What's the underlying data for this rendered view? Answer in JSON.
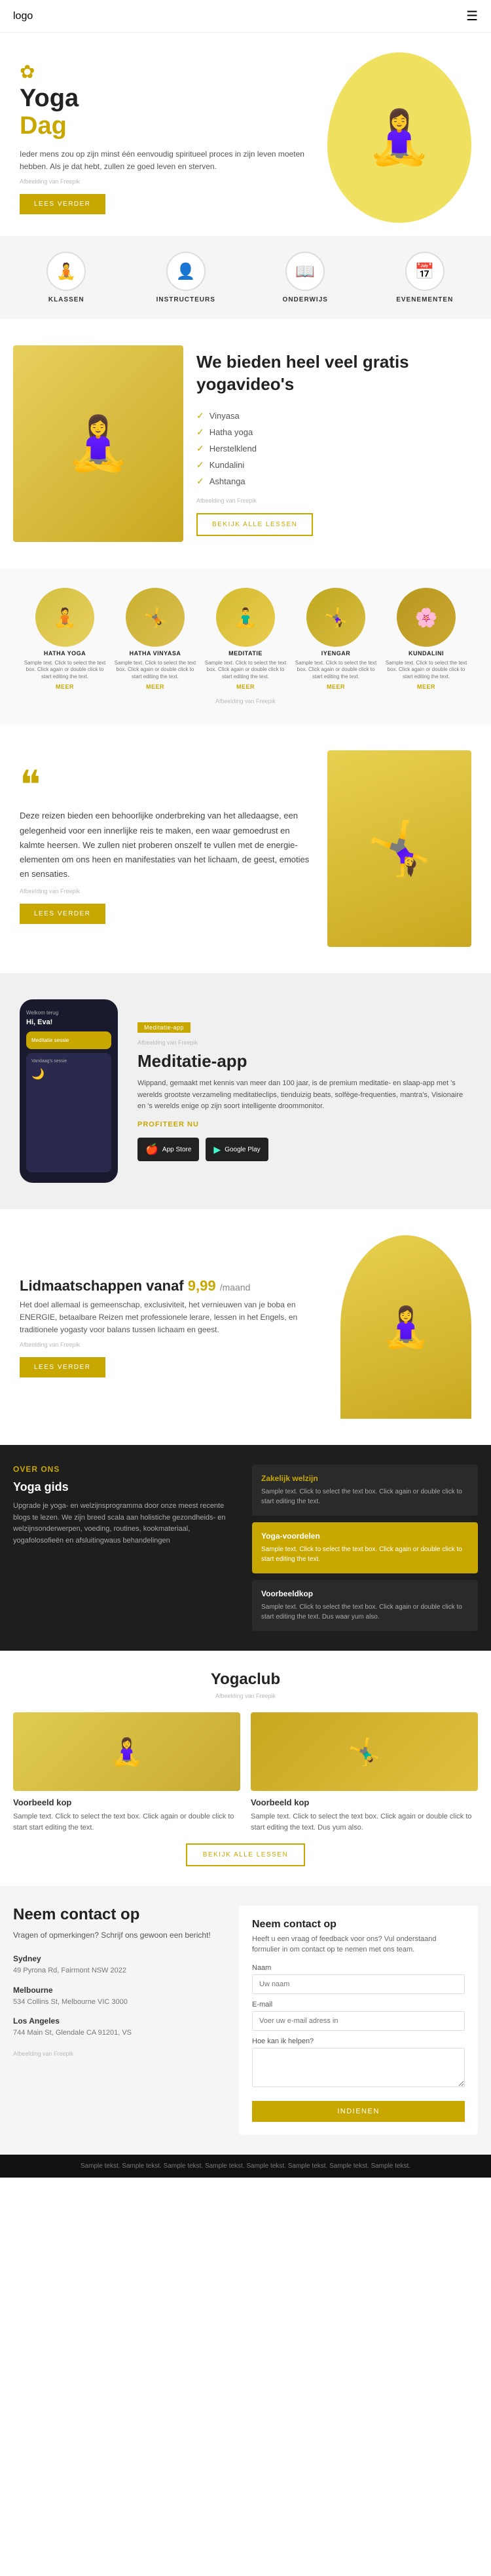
{
  "nav": {
    "logo": "logo",
    "menu_icon": "☰"
  },
  "hero": {
    "lotus_icon": "✿",
    "title_line1": "Yoga",
    "title_line2": "Dag",
    "description": "Ieder mens zou op zijn minst één eenvoudig spiritueel proces in zijn leven moeten hebben. Als je dat hebt, zullen ze goed leven en sterven.",
    "image_credit": "Afbeelding van Freepik",
    "btn_label": "LEES VERDER"
  },
  "icon_grid": {
    "items": [
      {
        "icon": "🧘",
        "label": "KLASSEN"
      },
      {
        "icon": "👤",
        "label": "INSTRUCTEURS"
      },
      {
        "icon": "📖",
        "label": "ONDERWIJS"
      },
      {
        "icon": "📅",
        "label": "EVENEMENTEN"
      }
    ]
  },
  "video_section": {
    "title": "We bieden heel veel gratis yogavideo's",
    "list": [
      "Vinyasa",
      "Hatha yoga",
      "Herstelklend",
      "Kundalini",
      "Ashtanga"
    ],
    "image_credit": "Afbeelding van Freepik",
    "btn_label": "BEKIJK ALLE LESSEN"
  },
  "classes": {
    "items": [
      {
        "name": "HATHA YOGA",
        "desc": "Sample text. Click to select the text box. Click again or double click to start editing the text.",
        "link": "MEER"
      },
      {
        "name": "HATHA VINYASA",
        "desc": "Sample text. Click to select the text box. Click again or double click to start editing the text.",
        "link": "MEER"
      },
      {
        "name": "MEDITATIE",
        "desc": "Sample text. Click to select the text box. Click again or double click to start editing the text.",
        "link": "MEER"
      },
      {
        "name": "IYENGAR",
        "desc": "Sample text. Click to select the text box. Click again or double click to start editing the text.",
        "link": "MEER"
      },
      {
        "name": "KUNDALINI",
        "desc": "Sample text. Click to select the text box. Click again or double click to start editing the text.",
        "link": "MEER"
      }
    ],
    "credit": "Afbeelding van Freepik"
  },
  "quote": {
    "mark": "❝",
    "body": "Deze reizen bieden een behoorlijke onderbreking van het alledaagse, een gelegenheid voor een innerlijke reis te maken, een waar gemoedrust en kalmte heersen. We zullen niet proberen onszelf te vullen met de energie-elementen om ons heen en manifestaties van het lichaam, de geest, emoties en sensaties.",
    "credit": "Afbeelding van Freepik",
    "btn_label": "LEES VERDER"
  },
  "app": {
    "badge": "Meditatie-app",
    "credit": "Afbeelding van Freepik",
    "phone_greeting": "Hi, Eva!",
    "phone_header": "Welkom terug",
    "title": "Meditatie-app",
    "description": "Wippand, gemaakt met kennis van meer dan 100 jaar, is de premium meditatie- en slaap-app met 's werelds grootste verzameling meditatieclips, tienduizig beats, solfège-frequenties, mantra's, Visionaire en 's werelds enige op zijn soort intelligente droommonitor.",
    "cta": "PROFITEER NU",
    "app_store_label": "App Store",
    "google_play_label": "Google Play",
    "app_store_icon": "🍎",
    "google_play_icon": "▶"
  },
  "membership": {
    "label": "Lidmaatschappen vanaf",
    "currency": "$",
    "price": "9,99",
    "period": "/maand",
    "description": "Het doel allemaal is gemeenschap, exclusiviteit, het vernieuwen van je boba en ENERGIE, betaalbare Reizen met professionele lerare, lessen in het Engels, en traditionele yogasty voor balans tussen lichaam en geest.",
    "credit": "Afbeelding van Freepik",
    "btn_label": "LEES VERDER"
  },
  "about": {
    "heading": "OVER ONS",
    "title": "Yoga gids",
    "description": "Upgrade je yoga- en welzijnsprogramma door onze meest recente blogs te lezen. We zijn breed scala aan holistiche gezondheids- en welzijnsonderwerpen, voeding, routines, kookmateriaal, yogafolosofieën en afsluitingwaus behandelingen",
    "zakelijk": {
      "heading": "Zakelijk welzijn",
      "desc": "Sample text. Click to select the text box. Click again or double click to start editing the text."
    },
    "yoga_benefits": {
      "title": "Yoga-voordelen",
      "desc": "Sample text. Click to select the text box. Click again or double click to start editing the text."
    },
    "box1": {
      "title": "Voorbeeldkop",
      "desc": "Sample text. Click to select the text box. Click again or double click to start editing the text. Dus waar yum also."
    }
  },
  "yogaclub": {
    "title": "Yogaclub",
    "credit": "Afbeelding van Freepik",
    "col1_head": "Voorbeeld kop",
    "col1_desc": "Sample text. Click to select the text box. Click again or double click to start start editing the text.",
    "col2_head": "Voorbeeld kop",
    "col2_desc": "Sample text. Click to select the text box. Click again or double click to start editing the text. Dus yum also.",
    "btn_label": "BEKIJK ALLE LESSEN"
  },
  "contact_left": {
    "title": "Neem contact op",
    "subtitle": "Vragen of opmerkingen? Schrijf ons gewoon een bericht!",
    "locations": [
      {
        "city": "Sydney",
        "addr": "49 Pyrona Rd, Fairmont NSW 2022"
      },
      {
        "city": "Melbourne",
        "addr": "534 Collins St, Melbourne VIC 3000"
      },
      {
        "city": "Los Angeles",
        "addr": "744 Main St, Glendale CA 91201, VS"
      }
    ],
    "credit": "Afbeelding van Freepik"
  },
  "contact_right": {
    "title": "Neem contact op",
    "subtitle": "Heeft u een vraag of feedback voor ons? Vul onderstaand formulier in om contact op te nemen met ons team.",
    "fields": {
      "name_label": "Naam",
      "name_placeholder": "Uw naam",
      "email_label": "E-mail",
      "email_placeholder": "Voer uw e-mail adress in",
      "message_label": "Hoe kan ik helpen?",
      "message_placeholder": ""
    },
    "btn_label": "INDIENEN"
  },
  "footer": {
    "text": "Sample tekst. Sample tekst. Sample tekst. Sample tekst. Sample tekst. Sample tekst. Sample tekst. Sample tekst."
  }
}
